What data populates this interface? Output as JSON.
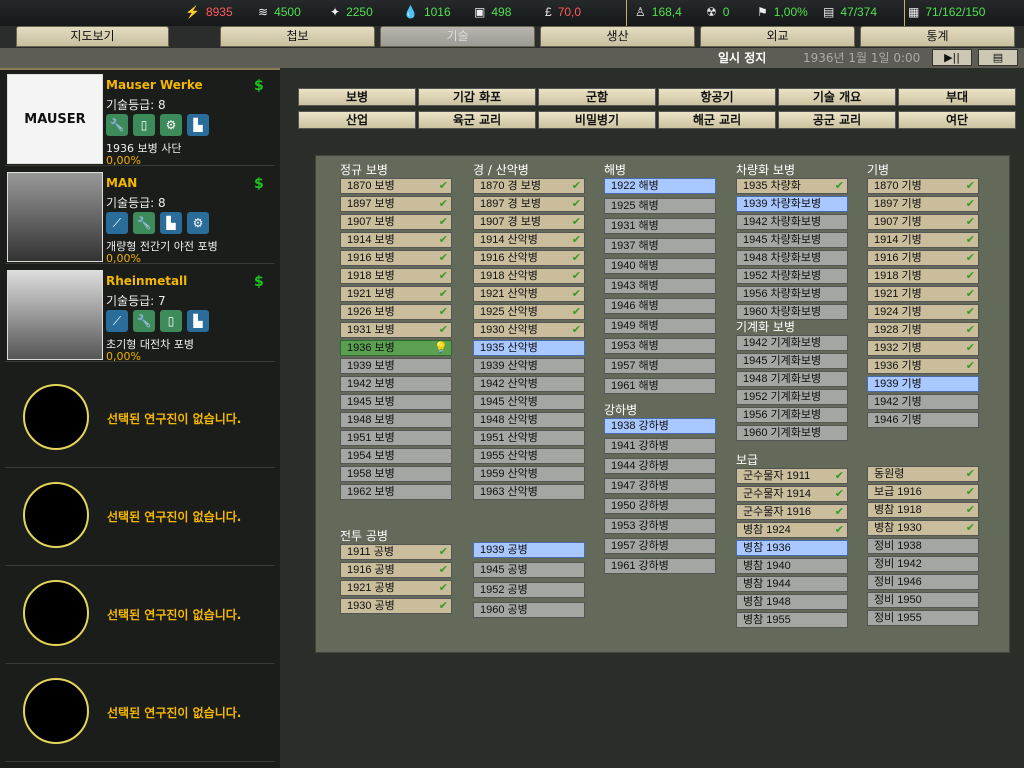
{
  "resources": [
    {
      "icon": "energy-icon",
      "glyph": "⚡",
      "value": "8935",
      "color": "red"
    },
    {
      "icon": "metal-icon",
      "glyph": "≋",
      "value": "4500",
      "color": "grn"
    },
    {
      "icon": "rare-materials-icon",
      "glyph": "✦",
      "value": "2250",
      "color": "grn"
    },
    {
      "icon": "oil-icon",
      "glyph": "💧",
      "value": "1016",
      "color": "grn"
    },
    {
      "icon": "supplies-icon",
      "glyph": "▣",
      "value": "498",
      "color": "grn"
    },
    {
      "icon": "money-icon",
      "glyph": "£",
      "value": "70,0",
      "color": "red"
    },
    {
      "icon": "manpower-icon",
      "glyph": "♙",
      "value": "168,4",
      "color": "grn"
    },
    {
      "icon": "nuke-icon",
      "glyph": "☢",
      "value": "0",
      "color": "grn"
    },
    {
      "icon": "dissent-icon",
      "glyph": "⚑",
      "value": "1,00%",
      "color": "grn"
    },
    {
      "icon": "transport-icon",
      "glyph": "▤",
      "value": "47/374",
      "color": "grn"
    },
    {
      "icon": "ic-icon",
      "glyph": "▦",
      "value": "71/162/150",
      "color": "grn"
    }
  ],
  "tabs": [
    "지도보기",
    "첩보",
    "기술",
    "생산",
    "외교",
    "통계"
  ],
  "status": {
    "paused": "일시 정지",
    "date": "1936년 1월 1일 0:00",
    "play": "▶||",
    "menu": "▤"
  },
  "teams": [
    {
      "name": "Mauser Werke",
      "skill": "기술등급: 8",
      "project": "1936 보병 사단",
      "progress": "0,00%",
      "dollar": "$"
    },
    {
      "name": "MAN",
      "skill": "기술등급: 8",
      "project": "개량형 전간기 야전 포병",
      "progress": "0,00%",
      "dollar": "$"
    },
    {
      "name": "Rheinmetall",
      "skill": "기술등급: 7",
      "project": "초기형 대전차 포병",
      "progress": "0,00%",
      "dollar": "$"
    }
  ],
  "empty_slot": "선택된 연구진이 없습니다.",
  "categories": [
    [
      "보병",
      "기갑 화포",
      "군함",
      "항공기",
      "기술 개요",
      "부대"
    ],
    [
      "산업",
      "육군 교리",
      "비밀병기",
      "해군 교리",
      "공군 교리",
      "여단"
    ]
  ],
  "groups": [
    {
      "header": "정규 보병",
      "items": [
        [
          "1870 보병",
          "done"
        ],
        [
          "1897 보병",
          "done"
        ],
        [
          "1907 보병",
          "done"
        ],
        [
          "1914 보병",
          "done"
        ],
        [
          "1916 보병",
          "done"
        ],
        [
          "1918 보병",
          "done"
        ],
        [
          "1921 보병",
          "done"
        ],
        [
          "1926 보병",
          "done"
        ],
        [
          "1931 보병",
          "done"
        ],
        [
          "1936 보병",
          "active"
        ],
        [
          "1939 보병",
          "locked"
        ],
        [
          "1942 보병",
          "locked"
        ],
        [
          "1945 보병",
          "locked"
        ],
        [
          "1948 보병",
          "locked"
        ],
        [
          "1951 보병",
          "locked"
        ],
        [
          "1954 보병",
          "locked"
        ],
        [
          "1958 보병",
          "locked"
        ],
        [
          "1962 보병",
          "locked"
        ]
      ]
    },
    {
      "header": "경 / 산악병",
      "items": [
        [
          "1870 경 보병",
          "done"
        ],
        [
          "1897 경 보병",
          "done"
        ],
        [
          "1907 경 보병",
          "done"
        ],
        [
          "1914 산악병",
          "done"
        ],
        [
          "1916 산악병",
          "done"
        ],
        [
          "1918 산악병",
          "done"
        ],
        [
          "1921 산악병",
          "done"
        ],
        [
          "1925 산악병",
          "done"
        ],
        [
          "1930 산악병",
          "done"
        ],
        [
          "1935 산악병",
          "sel"
        ],
        [
          "1939 산악병",
          "locked"
        ],
        [
          "1942 산악병",
          "locked"
        ],
        [
          "1945 산악병",
          "locked"
        ],
        [
          "1948 산악병",
          "locked"
        ],
        [
          "1951 산악병",
          "locked"
        ],
        [
          "1955 산악병",
          "locked"
        ],
        [
          "1959 산악병",
          "locked"
        ],
        [
          "1963 산악병",
          "locked"
        ]
      ]
    },
    {
      "header": "해병",
      "items": [
        [
          "1922 해병",
          "sel"
        ],
        [
          "1925 해병",
          "locked"
        ],
        [
          "1931 해병",
          "locked"
        ],
        [
          "1937 해병",
          "locked"
        ],
        [
          "1940 해병",
          "locked"
        ],
        [
          "1943 해병",
          "locked"
        ],
        [
          "1946 해병",
          "locked"
        ],
        [
          "1949 해병",
          "locked"
        ],
        [
          "1953 해병",
          "locked"
        ],
        [
          "1957 해병",
          "locked"
        ],
        [
          "1961 해병",
          "locked"
        ]
      ]
    },
    {
      "header": "강하병",
      "items": [
        [
          "1938 강하병",
          "sel"
        ],
        [
          "1941 강하병",
          "locked"
        ],
        [
          "1944 강하병",
          "locked"
        ],
        [
          "1947 강하병",
          "locked"
        ],
        [
          "1950 강하병",
          "locked"
        ],
        [
          "1953 강하병",
          "locked"
        ],
        [
          "1957 강하병",
          "locked"
        ],
        [
          "1961 강하병",
          "locked"
        ]
      ]
    },
    {
      "header": "차량화 보병",
      "items": [
        [
          "1935 차량화",
          "done"
        ],
        [
          "1939 차량화보병",
          "sel"
        ],
        [
          "1942 차량화보병",
          "locked"
        ],
        [
          "1945 차량화보병",
          "locked"
        ],
        [
          "1948 차량화보병",
          "locked"
        ],
        [
          "1952 차량화보병",
          "locked"
        ],
        [
          "1956 차량화보병",
          "locked"
        ],
        [
          "1960 차량화보병",
          "locked"
        ]
      ]
    },
    {
      "header": "기계화 보병",
      "items": [
        [
          "1942 기계화보병",
          "locked"
        ],
        [
          "1945 기계화보병",
          "locked"
        ],
        [
          "1948 기계화보병",
          "locked"
        ],
        [
          "1952 기계화보병",
          "locked"
        ],
        [
          "1956 기계화보병",
          "locked"
        ],
        [
          "1960 기계화보병",
          "locked"
        ]
      ]
    },
    {
      "header": "보급",
      "items": [
        [
          "군수물자 1911",
          "done"
        ],
        [
          "군수물자 1914",
          "done"
        ],
        [
          "군수물자 1916",
          "done"
        ],
        [
          "병참 1924",
          "done"
        ],
        [
          "병참 1936",
          "sel"
        ],
        [
          "병참 1940",
          "locked"
        ],
        [
          "병참 1944",
          "locked"
        ],
        [
          "병참 1948",
          "locked"
        ],
        [
          "병참 1955",
          "locked"
        ]
      ]
    },
    {
      "header": "기병",
      "items": [
        [
          "1870 기병",
          "done"
        ],
        [
          "1897 기병",
          "done"
        ],
        [
          "1907 기병",
          "done"
        ],
        [
          "1914 기병",
          "done"
        ],
        [
          "1916 기병",
          "done"
        ],
        [
          "1918 기병",
          "done"
        ],
        [
          "1921 기병",
          "done"
        ],
        [
          "1924 기병",
          "done"
        ],
        [
          "1928 기병",
          "done"
        ],
        [
          "1932 기병",
          "done"
        ],
        [
          "1936 기병",
          "done"
        ],
        [
          "1939 기병",
          "sel"
        ],
        [
          "1942 기병",
          "locked"
        ],
        [
          "1946 기병",
          "locked"
        ]
      ]
    },
    {
      "items": [
        [
          "동원령",
          "done"
        ],
        [
          "보급 1916",
          "done"
        ],
        [
          "병참 1918",
          "done"
        ],
        [
          "병참 1930",
          "done"
        ],
        [
          "정비 1938",
          "locked"
        ],
        [
          "정비 1942",
          "locked"
        ],
        [
          "정비 1946",
          "locked"
        ],
        [
          "정비 1950",
          "locked"
        ],
        [
          "정비 1955",
          "locked"
        ]
      ]
    },
    {
      "header": "전투 공병",
      "items": [
        [
          "1911 공병",
          "done"
        ],
        [
          "1916 공병",
          "done"
        ],
        [
          "1921 공병",
          "done"
        ],
        [
          "1930 공병",
          "done"
        ]
      ]
    },
    {
      "items": [
        [
          "1939 공병",
          "sel"
        ],
        [
          "1945 공병",
          "locked"
        ],
        [
          "1952 공병",
          "locked"
        ],
        [
          "1960 공병",
          "locked"
        ]
      ]
    }
  ]
}
